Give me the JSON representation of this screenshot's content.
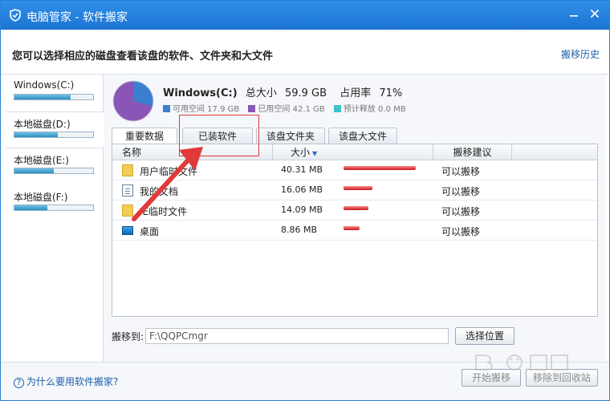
{
  "window": {
    "title": "电脑管家 - 软件搬家"
  },
  "header": {
    "hint": "您可以选择相应的磁盘查看该盘的软件、文件夹和大文件",
    "history_link": "搬移历史"
  },
  "sidebar": {
    "drives": [
      {
        "label": "Windows(C:)",
        "usage": 0.71
      },
      {
        "label": "本地磁盘(D:)",
        "usage": 0.55
      },
      {
        "label": "本地磁盘(E:)",
        "usage": 0.5
      },
      {
        "label": "本地磁盘(F:)",
        "usage": 0.42
      }
    ]
  },
  "drive_info": {
    "name": "Windows(C:)",
    "total_label": "总大小",
    "total_value": "59.9 GB",
    "usage_label": "占用率",
    "usage_value": "71%",
    "used_fraction": 0.71,
    "legend": [
      {
        "label": "可用空间 17.9 GB",
        "color": "#3b7fcf"
      },
      {
        "label": "已用空间 42.1 GB",
        "color": "#8a55b6"
      },
      {
        "label": "预计释放 0.0 MB",
        "color": "#3cc3c9"
      }
    ]
  },
  "tabs": [
    {
      "label": "重要数据"
    },
    {
      "label": "已装软件"
    },
    {
      "label": "该盘文件夹"
    },
    {
      "label": "该盘大文件"
    }
  ],
  "list": {
    "columns": {
      "name": "名称",
      "size": "大小",
      "suggest": "搬移建议"
    },
    "rows": [
      {
        "name": "用户临时文件",
        "size": "40.31 MB",
        "size_mb": 40.31,
        "suggest": "可以搬移",
        "icon": "folder-icon"
      },
      {
        "name": "我的文档",
        "size": "16.06 MB",
        "size_mb": 16.06,
        "suggest": "可以搬移",
        "icon": "document-icon"
      },
      {
        "name": "IE临时文件",
        "size": "14.09 MB",
        "size_mb": 14.09,
        "suggest": "可以搬移",
        "icon": "folder-icon"
      },
      {
        "name": "桌面",
        "size": "8.86 MB",
        "size_mb": 8.86,
        "suggest": "可以搬移",
        "icon": "desktop-icon"
      }
    ]
  },
  "move_to": {
    "label": "搬移到:",
    "path": "F:\\QQPCmgr",
    "choose_button": "选择位置"
  },
  "actions": {
    "start_button": "开始搬移",
    "recycle_button": "移除到回收站"
  },
  "footer": {
    "why_link": "为什么要用软件搬家?"
  },
  "colors": {
    "titlebar": "#1d74d3",
    "accent": "#2a7fd4",
    "annotation": "#e03a3a",
    "size_bar": "#c5151b"
  }
}
